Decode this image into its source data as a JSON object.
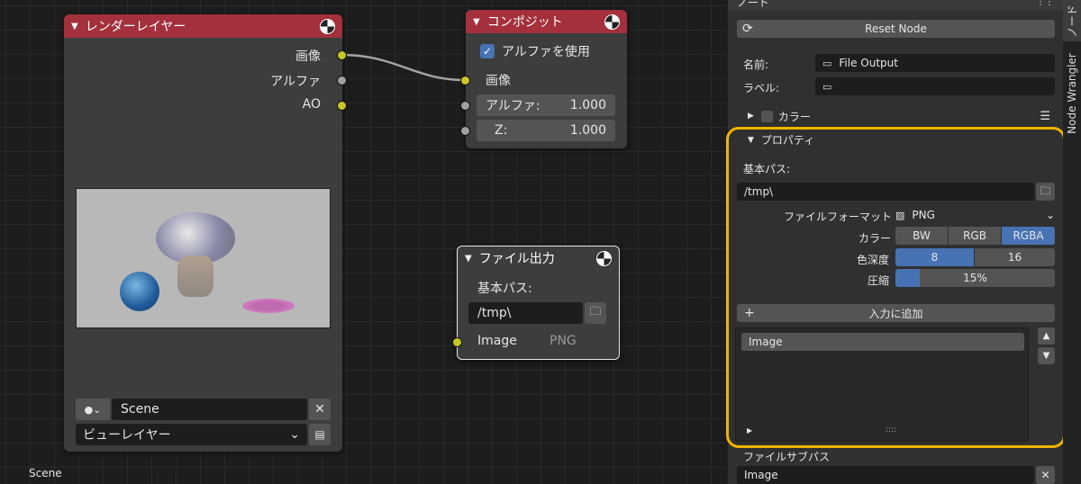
{
  "editor": {
    "scene_label": "Scene",
    "link_color": "#a3a3a3"
  },
  "render_layers": {
    "title": "レンダーレイヤー",
    "outputs": [
      "画像",
      "アルファ",
      "AO"
    ],
    "scene_value": "Scene",
    "view_layer_value": "ビューレイヤー",
    "header_color": "#a3303c"
  },
  "composite": {
    "title": "コンポジット",
    "use_alpha_label": "アルファを使用",
    "use_alpha_checked": true,
    "image_input": "画像",
    "alpha_label": "アルファ:",
    "alpha_value": "1.000",
    "z_label": "Z:",
    "z_value": "1.000"
  },
  "file_output_node": {
    "title": "ファイル出力",
    "base_path_label": "基本パス:",
    "base_path_value": "/tmp\\",
    "input_label": "Image",
    "input_format": "PNG"
  },
  "sidebar": {
    "header_title": "ノード",
    "reset_button": "Reset Node",
    "name_label": "名前:",
    "name_value": "File Output",
    "label_label": "ラベル:",
    "label_value": "",
    "color_label": "カラー",
    "properties_label": "プロパティ",
    "base_path_label": "基本パス:",
    "base_path_value": "/tmp\\",
    "file_format_label": "ファイルフォーマット",
    "file_format_value": "PNG",
    "color_mode_label": "カラー",
    "color_modes": [
      "BW",
      "RGB",
      "RGBA"
    ],
    "color_mode_selected": "RGBA",
    "color_depth_label": "色深度",
    "color_depths": [
      "8",
      "16"
    ],
    "color_depth_selected": "8",
    "compression_label": "圧縮",
    "compression_value": "15%",
    "compression_fraction": 0.15,
    "add_input_button": "入力に追加",
    "input_list": [
      "Image"
    ],
    "file_subpath_label": "ファイルサブパス",
    "file_subpath_value": "Image",
    "highlight_color": "#f0b400",
    "accent_color": "#4772b3"
  },
  "tabs": {
    "node_wrangler": "Node Wrangler",
    "node": "ノード"
  }
}
